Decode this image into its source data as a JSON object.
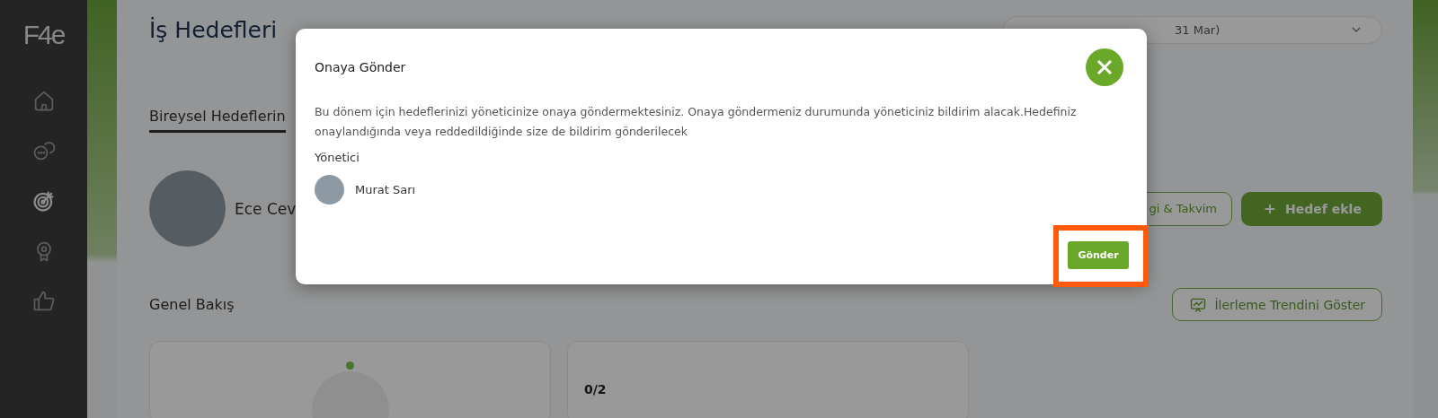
{
  "sidebar": {
    "logo": "F4e",
    "items": [
      {
        "selected": false
      },
      {
        "selected": false
      },
      {
        "selected": true
      },
      {
        "selected": false
      },
      {
        "selected": false
      }
    ]
  },
  "page": {
    "title": "İş Hedefleri",
    "period": "31 Mar)",
    "tabs": [
      {
        "label": "Bireysel Hedeflerin",
        "selected": true
      }
    ],
    "user": {
      "name": "Ece Cev"
    },
    "actions": [
      {
        "label": "gi & Takvim",
        "kind": "outline"
      },
      {
        "label": "Hedef ekle",
        "kind": "primary"
      }
    ],
    "overview": {
      "title": "Genel Bakış",
      "trend_button": "İlerleme Trendini Göster",
      "cards": [
        {
          "kind": "gauge"
        },
        {
          "kind": "count",
          "value": "0/2"
        }
      ]
    }
  },
  "modal": {
    "title": "Onaya Gönder",
    "message": "Bu dönem için hedeflerinizi yöneticinize onaya göndermektesiniz. Onaya göndermeniz durumunda yöneticiniz bildirim alacak.Hedefiniz onaylandığında veya reddedildiğinde size de bildirim gönderilecek",
    "manager_label": "Yönetici",
    "manager": {
      "name": "Murat Sarı"
    },
    "submit": {
      "label": "Gönder",
      "highlighted": true
    }
  }
}
